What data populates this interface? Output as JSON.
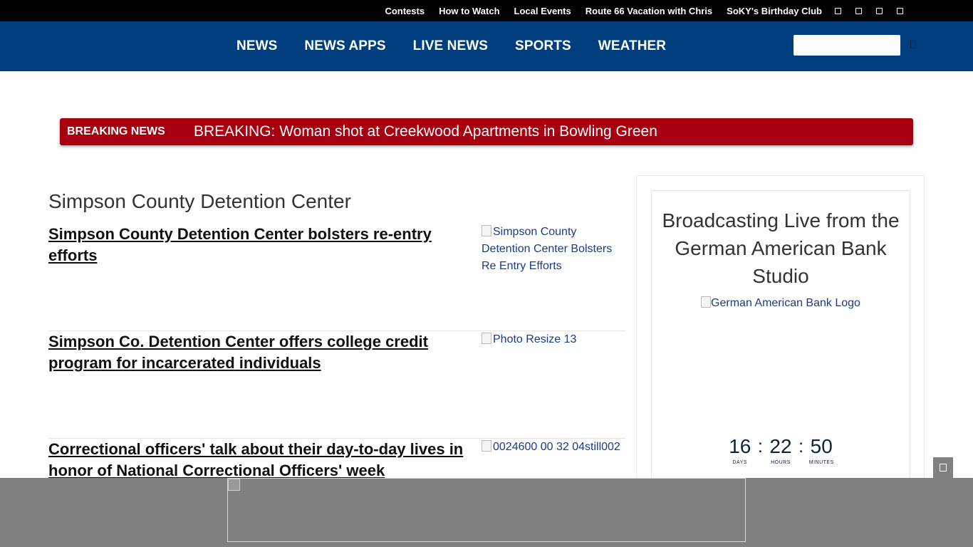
{
  "topbar": {
    "links": [
      "Contests",
      "How to Watch",
      "Local Events",
      "Route 66 Vacation with Chris",
      "SoKY's Birthday Club"
    ],
    "social_icons": [
      "facebook-icon",
      "twitter-icon",
      "instagram-icon",
      "youtube-icon"
    ]
  },
  "nav": {
    "items": [
      "NEWS",
      "NEWS APPS",
      "LIVE NEWS",
      "SPORTS",
      "WEATHER"
    ],
    "search_placeholder": "",
    "search_icon": "search-icon"
  },
  "breaking": {
    "label": "Breaking News",
    "headline": "BREAKING: Woman shot at Creekwood Apartments in Bowling Green"
  },
  "section": {
    "title": "Simpson County Detention Center"
  },
  "stories": [
    {
      "headline": "Simpson County Detention Center bolsters re-entry efforts",
      "image_alt": "Simpson County Detention Center Bolsters Re Entry Efforts"
    },
    {
      "headline": "Simpson Co. Detention Center offers college credit program for incarcerated individuals",
      "image_alt": "Photo Resize 13"
    },
    {
      "headline": "Correctional officers' talk about their day-to-day lives in honor of National Correctional Officers' week",
      "image_alt": "0024600 00 32 04still002"
    }
  ],
  "sidebar": {
    "title": "Broadcasting Live from the German American Bank Studio",
    "logo_alt": "German American Bank Logo",
    "countdown": {
      "days": "16",
      "hours": "22",
      "minutes": "50",
      "days_label": "Days",
      "hours_label": "Hours",
      "minutes_label": "Minutes",
      "separator": ":"
    }
  },
  "colors": {
    "topbar": "#000000",
    "nav": "#003e7e",
    "breaking": "#a8000f",
    "ad_overlay": "#808080"
  }
}
